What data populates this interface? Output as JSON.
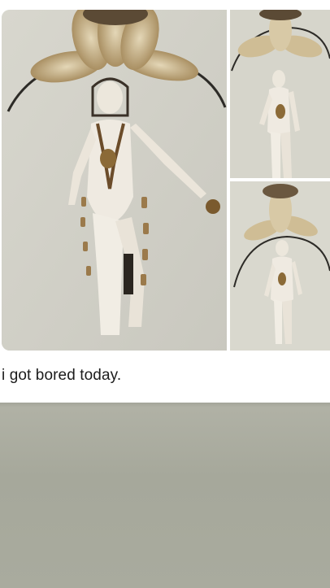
{
  "post": {
    "caption": "i got bored today."
  },
  "photos": [
    {
      "role": "main",
      "subject": "doll-with-feather-headdress"
    },
    {
      "role": "side-top",
      "subject": "doll-with-feather-headdress"
    },
    {
      "role": "side-bottom",
      "subject": "doll-with-feather-headdress"
    }
  ],
  "colors": {
    "card_background": "#ffffff",
    "page_background": "#a8aa9c",
    "caption_text": "#1c1c1c"
  }
}
